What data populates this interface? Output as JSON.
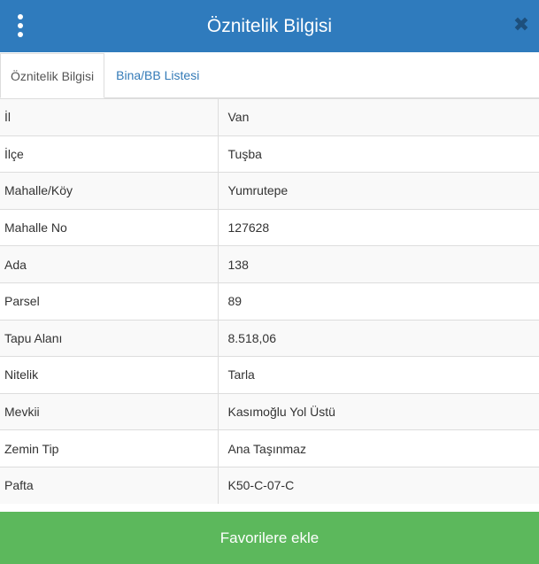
{
  "header": {
    "title": "Öznitelik Bilgisi",
    "menu_icon": "vertical-ellipsis-icon",
    "close_icon": "close-icon",
    "close_glyph": "✖"
  },
  "tabs": [
    {
      "label": "Öznitelik Bilgisi",
      "active": true
    },
    {
      "label": "Bina/BB Listesi",
      "active": false
    }
  ],
  "attributes": [
    {
      "key": "İl",
      "value": "Van"
    },
    {
      "key": "İlçe",
      "value": "Tuşba"
    },
    {
      "key": "Mahalle/Köy",
      "value": "Yumrutepe"
    },
    {
      "key": "Mahalle No",
      "value": "127628"
    },
    {
      "key": "Ada",
      "value": "138"
    },
    {
      "key": "Parsel",
      "value": "89"
    },
    {
      "key": "Tapu Alanı",
      "value": "8.518,06"
    },
    {
      "key": "Nitelik",
      "value": "Tarla"
    },
    {
      "key": "Mevkii",
      "value": "Kasımoğlu Yol Üstü"
    },
    {
      "key": "Zemin Tip",
      "value": "Ana Taşınmaz"
    },
    {
      "key": "Pafta",
      "value": "K50-C-07-C"
    }
  ],
  "footer": {
    "favorite_label": "Favorilere ekle"
  },
  "colors": {
    "header_bg": "#2f7bbd",
    "tab_link": "#337ab7",
    "button_green": "#5cb85c",
    "close_icon": "#1d4f7c"
  }
}
